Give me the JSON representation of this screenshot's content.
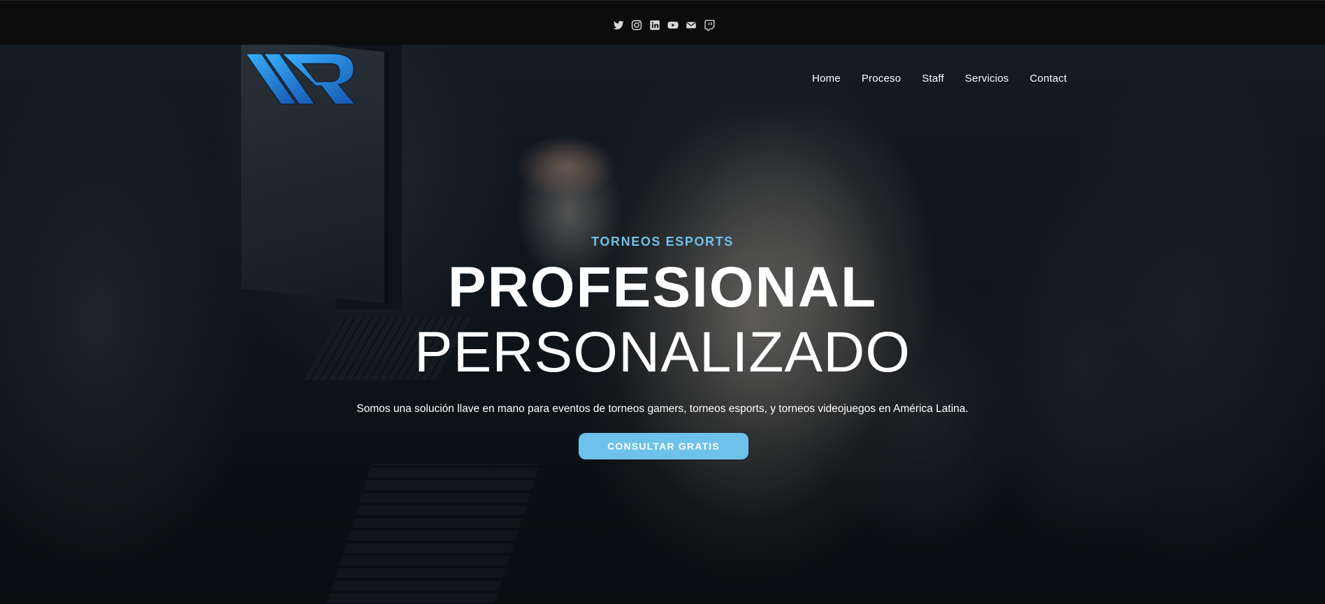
{
  "social": {
    "icons": [
      "twitter-icon",
      "instagram-icon",
      "linkedin-icon",
      "youtube-icon",
      "envelope-icon",
      "twitch-icon"
    ]
  },
  "nav": {
    "items": [
      {
        "label": "Home"
      },
      {
        "label": "Proceso"
      },
      {
        "label": "Staff"
      },
      {
        "label": "Servicios"
      },
      {
        "label": "Contact"
      }
    ]
  },
  "hero": {
    "eyebrow": "TORNEOS ESPORTS",
    "title": "PROFESIONAL",
    "subtitle": "PERSONALIZADO",
    "description": "Somos una solución llave en mano para eventos de torneos gamers, torneos esports, y torneos videojuegos en América Latina.",
    "cta_label": "CONSULTAR GRATIS"
  },
  "colors": {
    "accent": "#6ec1ea",
    "logo_blue": "#1e8ad6",
    "topbar": "#0c0c0c"
  }
}
